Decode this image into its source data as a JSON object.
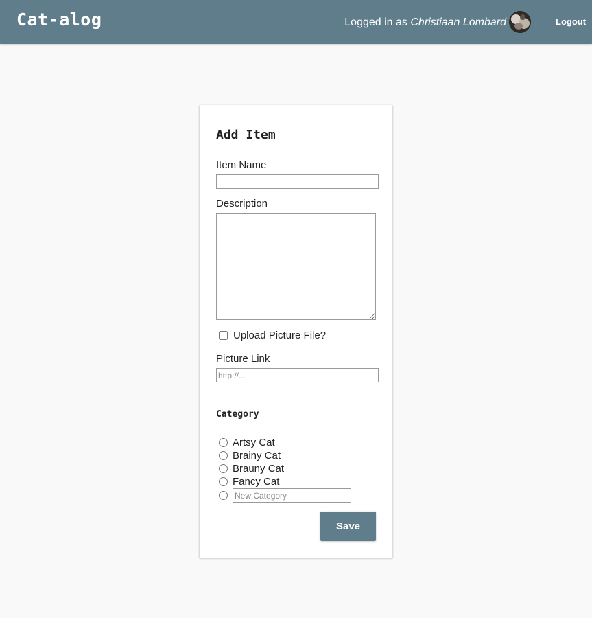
{
  "header": {
    "brand": "Cat-alog",
    "login_prefix": "Logged in as",
    "user_name": "Christiaan Lombard",
    "logout_label": "Logout",
    "background_color": "#607d8b"
  },
  "form": {
    "title": "Add Item",
    "item_name": {
      "label": "Item Name",
      "value": ""
    },
    "description": {
      "label": "Description",
      "value": ""
    },
    "upload_checkbox": {
      "label": "Upload Picture File?",
      "checked": false
    },
    "picture_link": {
      "label": "Picture Link",
      "placeholder": "http://...",
      "value": ""
    },
    "category": {
      "title": "Category",
      "options": [
        {
          "label": "Artsy Cat",
          "selected": false
        },
        {
          "label": "Brainy Cat",
          "selected": false
        },
        {
          "label": "Brauny Cat",
          "selected": false
        },
        {
          "label": "Fancy Cat",
          "selected": false
        }
      ],
      "new_category_placeholder": "New Category"
    },
    "save_label": "Save"
  },
  "icons": {
    "avatar": "user-avatar-photo"
  }
}
